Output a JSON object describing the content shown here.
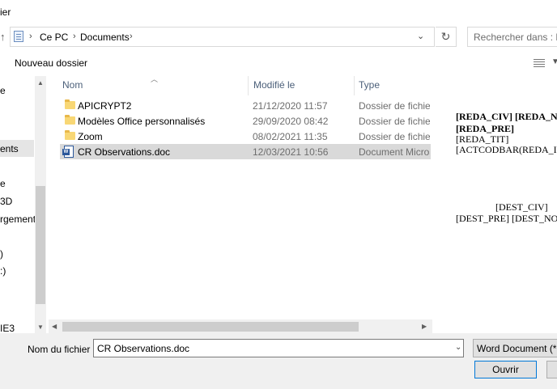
{
  "window": {
    "title": "ier"
  },
  "address": {
    "crumbs": [
      "Ce PC",
      "Documents"
    ]
  },
  "search": {
    "placeholder": "Rechercher dans : Doc"
  },
  "toolbar": {
    "new_folder_label": "Nouveau dossier"
  },
  "nav": {
    "items": [
      "e",
      "ents",
      "e",
      "3D",
      "rgements",
      ")",
      ":)",
      "IE3"
    ],
    "selected_index": 1
  },
  "columns": {
    "name": "Nom",
    "modified": "Modifié le",
    "type": "Type"
  },
  "files": [
    {
      "name": "APICRYPT2",
      "modified": "21/12/2020 11:57",
      "type": "Dossier de fichiers",
      "icon": "folder-icon"
    },
    {
      "name": "Modèles Office personnalisés",
      "modified": "29/09/2020 08:42",
      "type": "Dossier de fichiers",
      "icon": "folder-icon"
    },
    {
      "name": "Zoom",
      "modified": "08/02/2021 11:35",
      "type": "Dossier de fichiers",
      "icon": "folder-icon"
    },
    {
      "name": "CR Observations.doc",
      "modified": "12/03/2021 10:56",
      "type": "Document Micros...",
      "icon": "word-doc-icon"
    }
  ],
  "selected_file_index": 3,
  "preview": {
    "lines": [
      {
        "text": "[REDA_CIV] [REDA_N",
        "bold": true
      },
      {
        "text": "[REDA_PRE]",
        "bold": true
      },
      {
        "text": "[REDA_TIT]",
        "bold": false
      },
      {
        "text": "[ACTCODBAR(REDA_ID)]",
        "bold": false
      },
      {
        "text": "[DEST_CIV]",
        "bold": false
      },
      {
        "text": "[DEST_PRE] [DEST_NO",
        "bold": false
      }
    ]
  },
  "footer": {
    "filename_label": "Nom du fichier :",
    "filename_value": "CR Observations.doc",
    "filetype_value": "Word Document (*.do",
    "open_label": "Ouvrir"
  }
}
